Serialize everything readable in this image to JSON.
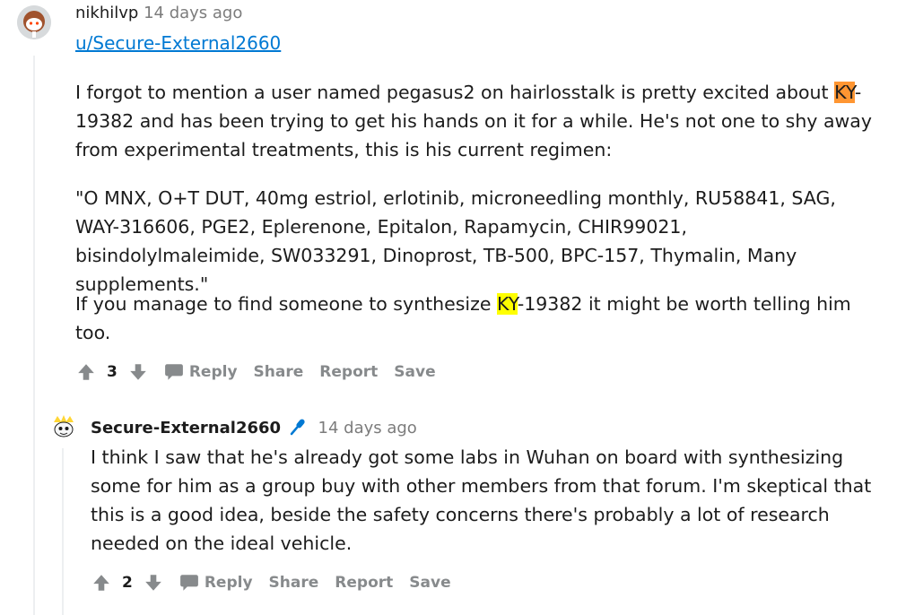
{
  "comment1": {
    "author": "nikhilvp",
    "time": "14 days ago",
    "mention": "u/Secure-External2660",
    "p1_pre": "I forgot to mention a user named pegasus2 on hairlosstalk is pretty excited about ",
    "p1_hl": "KY",
    "p1_post": "-19382 and has been trying to get his hands on it for a while. He's not one to shy away from experimental treatments, this is his current regimen:",
    "p2": "\"O MNX, O+T DUT, 40mg estriol, erlotinib, microneedling monthly, RU58841, SAG, WAY-316606, PGE2, Eplerenone, Epitalon, Rapamycin, CHIR99021, bisindolylmaleimide, SW033291, Dinoprost, TB-500, BPC-157, Thymalin, Many supplements.\"",
    "p3_pre": "If you manage to find someone to synthesize ",
    "p3_hl": "KY",
    "p3_post": "-19382 it might be worth telling him too.",
    "score": "3",
    "actions": {
      "reply": "Reply",
      "share": "Share",
      "report": "Report",
      "save": "Save"
    }
  },
  "comment2": {
    "author": "Secure-External2660",
    "time": "14 days ago",
    "text": "I think I saw that he's already got some labs in Wuhan on board with synthesizing some for him as a group buy with other members from that forum. I'm skeptical that this is a good idea, beside the safety concerns there's probably a lot of research needed on the ideal vehicle.",
    "score": "2",
    "actions": {
      "reply": "Reply",
      "share": "Share",
      "report": "Report",
      "save": "Save"
    }
  },
  "colors": {
    "link": "#0079d3",
    "meta": "#7c7c7c",
    "action": "#878a8c",
    "orange_highlight": "#ff9632",
    "yellow_highlight": "#ffff00"
  }
}
